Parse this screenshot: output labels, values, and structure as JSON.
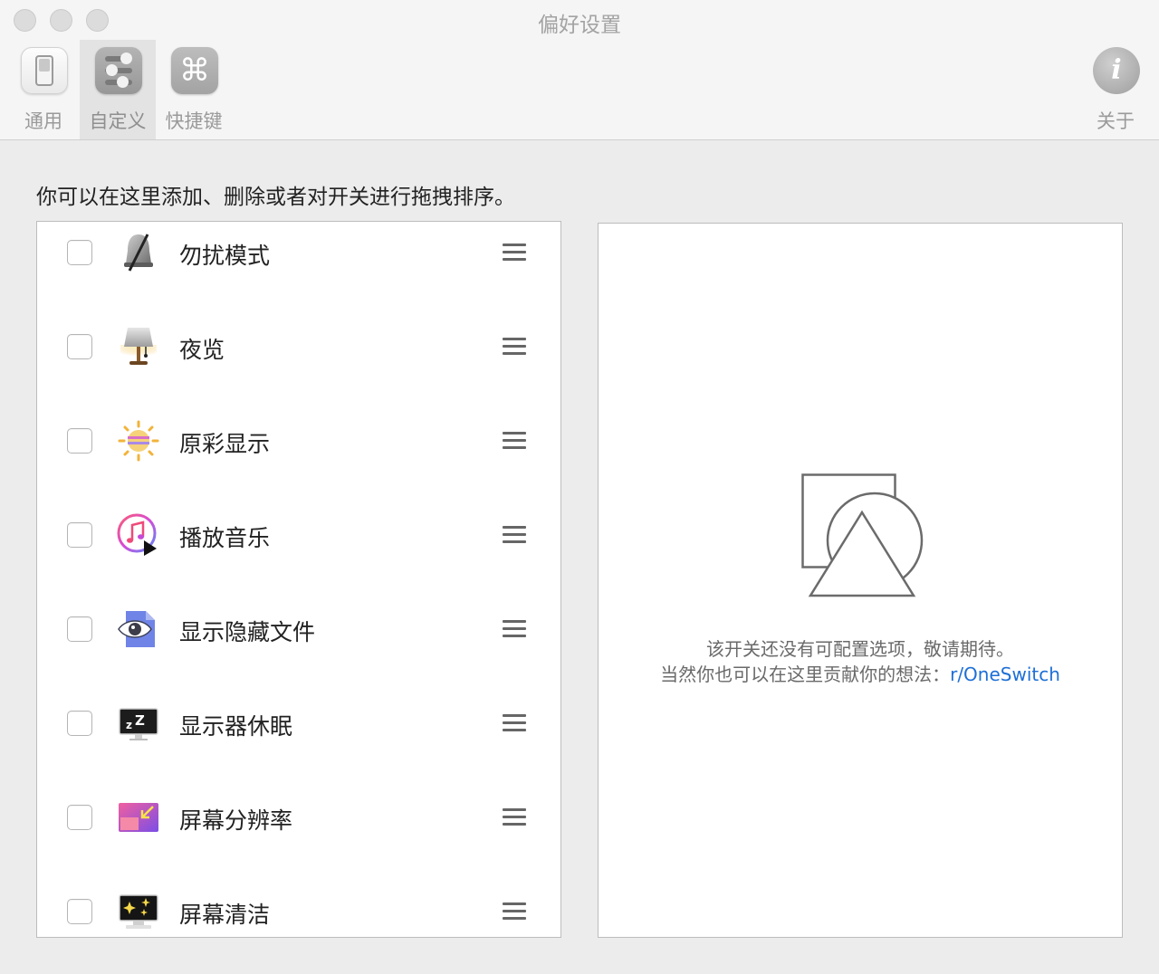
{
  "window": {
    "title": "偏好设置"
  },
  "toolbar": {
    "items": [
      {
        "label": "通用",
        "icon": "toggle-switch-icon"
      },
      {
        "label": "自定义",
        "icon": "sliders-icon",
        "selected": true
      },
      {
        "label": "快捷键",
        "icon": "command-key-icon"
      }
    ],
    "about": {
      "label": "关于",
      "icon": "info-icon",
      "glyph": "i"
    },
    "command_glyph": "⌘"
  },
  "main": {
    "instructions": "你可以在这里添加、删除或者对开关进行拖拽排序。",
    "switches": [
      {
        "label": "勿扰模式",
        "icon": "do-not-disturb-bell-icon",
        "checked": false
      },
      {
        "label": "夜览",
        "icon": "night-shift-lamp-icon",
        "checked": false
      },
      {
        "label": "原彩显示",
        "icon": "true-tone-sun-icon",
        "checked": false
      },
      {
        "label": "播放音乐",
        "icon": "music-play-icon",
        "checked": false
      },
      {
        "label": "显示隐藏文件",
        "icon": "hidden-files-eye-icon",
        "checked": false
      },
      {
        "label": "显示器休眠",
        "icon": "display-sleep-icon",
        "checked": false
      },
      {
        "label": "屏幕分辨率",
        "icon": "screen-resolution-icon",
        "checked": false
      },
      {
        "label": "屏幕清洁",
        "icon": "screen-cleaning-icon",
        "checked": false
      }
    ],
    "detail": {
      "message_line1": "该开关还没有可配置选项，敬请期待。",
      "message_line2_prefix": "当然你也可以在这里贡献你的想法：",
      "link_text": "r/OneSwitch",
      "link_color": "#1d6fd6"
    }
  }
}
